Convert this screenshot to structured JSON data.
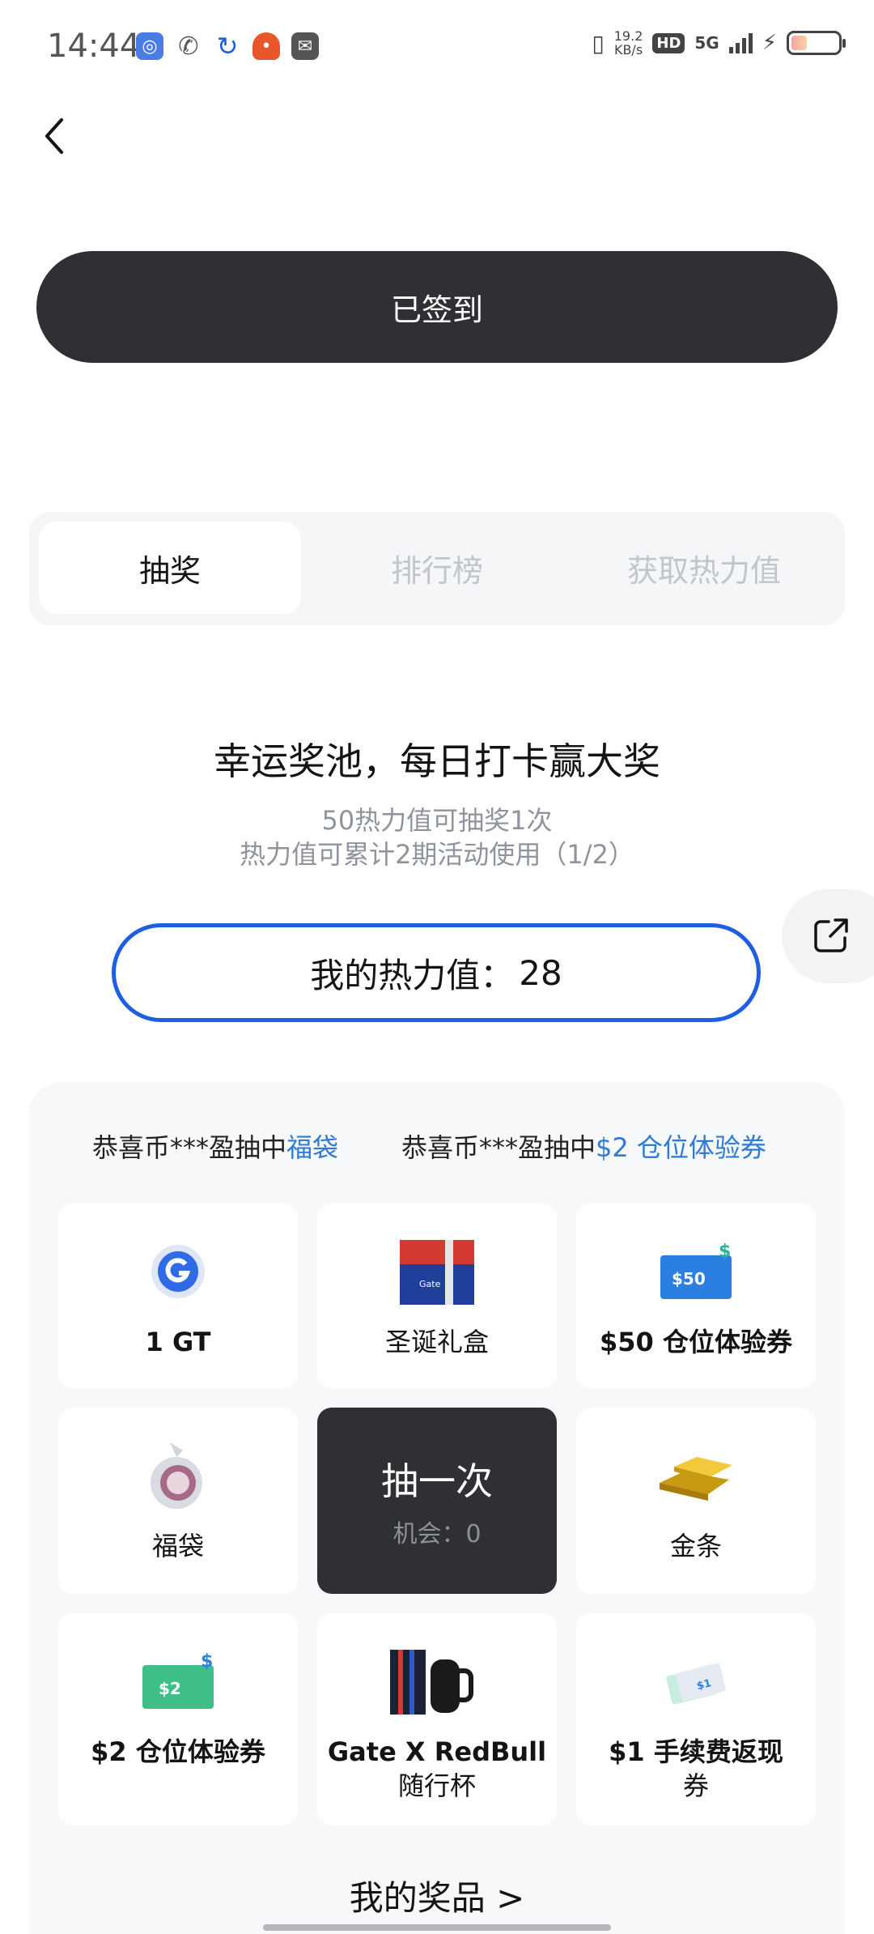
{
  "status_bar": {
    "time": "14:44",
    "net_speed_value": "19.2",
    "net_speed_unit": "KB/s",
    "hd_label": "HD",
    "network_label": "5G",
    "battery_level": 0.3
  },
  "header": {
    "signed_label": "已签到"
  },
  "tabs": [
    {
      "label": "抽奖",
      "active": true
    },
    {
      "label": "排行榜",
      "active": false
    },
    {
      "label": "获取热力值",
      "active": false
    }
  ],
  "lottery": {
    "headline": "幸运奖池，每日打卡赢大奖",
    "rule1": "50热力值可抽奖1次",
    "rule2": "热力值可累计2期活动使用（1/2）",
    "heat_label": "我的热力值：",
    "heat_value": "28"
  },
  "ticker": [
    {
      "prefix": "恭喜币***盈抽中",
      "prize": "福袋"
    },
    {
      "prefix": "恭喜币***盈抽中",
      "prize": "$2 仓位体验券"
    }
  ],
  "prizes": {
    "gt": {
      "label": "1 GT"
    },
    "gift_box": {
      "label": "圣诞礼盒",
      "box_text": "Gate"
    },
    "coupon50": {
      "label": "$50 仓位体验券",
      "ticket_text": "$50"
    },
    "lucky_bag": {
      "label": "福袋"
    },
    "gold_bar": {
      "label": "金条"
    },
    "coupon2": {
      "label": "$2 仓位体验券",
      "ticket_text": "$2"
    },
    "redbull_cup": {
      "label_line1": "Gate X RedBull",
      "label_line2": "随行杯"
    },
    "fee_rebate": {
      "label_line1": "$1 手续费返现",
      "label_line2": "券"
    }
  },
  "draw_button": {
    "label": "抽一次",
    "chances_label": "机会：",
    "chances": "0"
  },
  "footer": {
    "my_prizes": "我的奖品 >"
  },
  "colors": {
    "primary_dark": "#2f3034",
    "accent_blue": "#1d5fe0",
    "link_blue": "#2e7bd6",
    "muted_text": "#8f939b",
    "panel_bg": "#f7f8fa"
  }
}
